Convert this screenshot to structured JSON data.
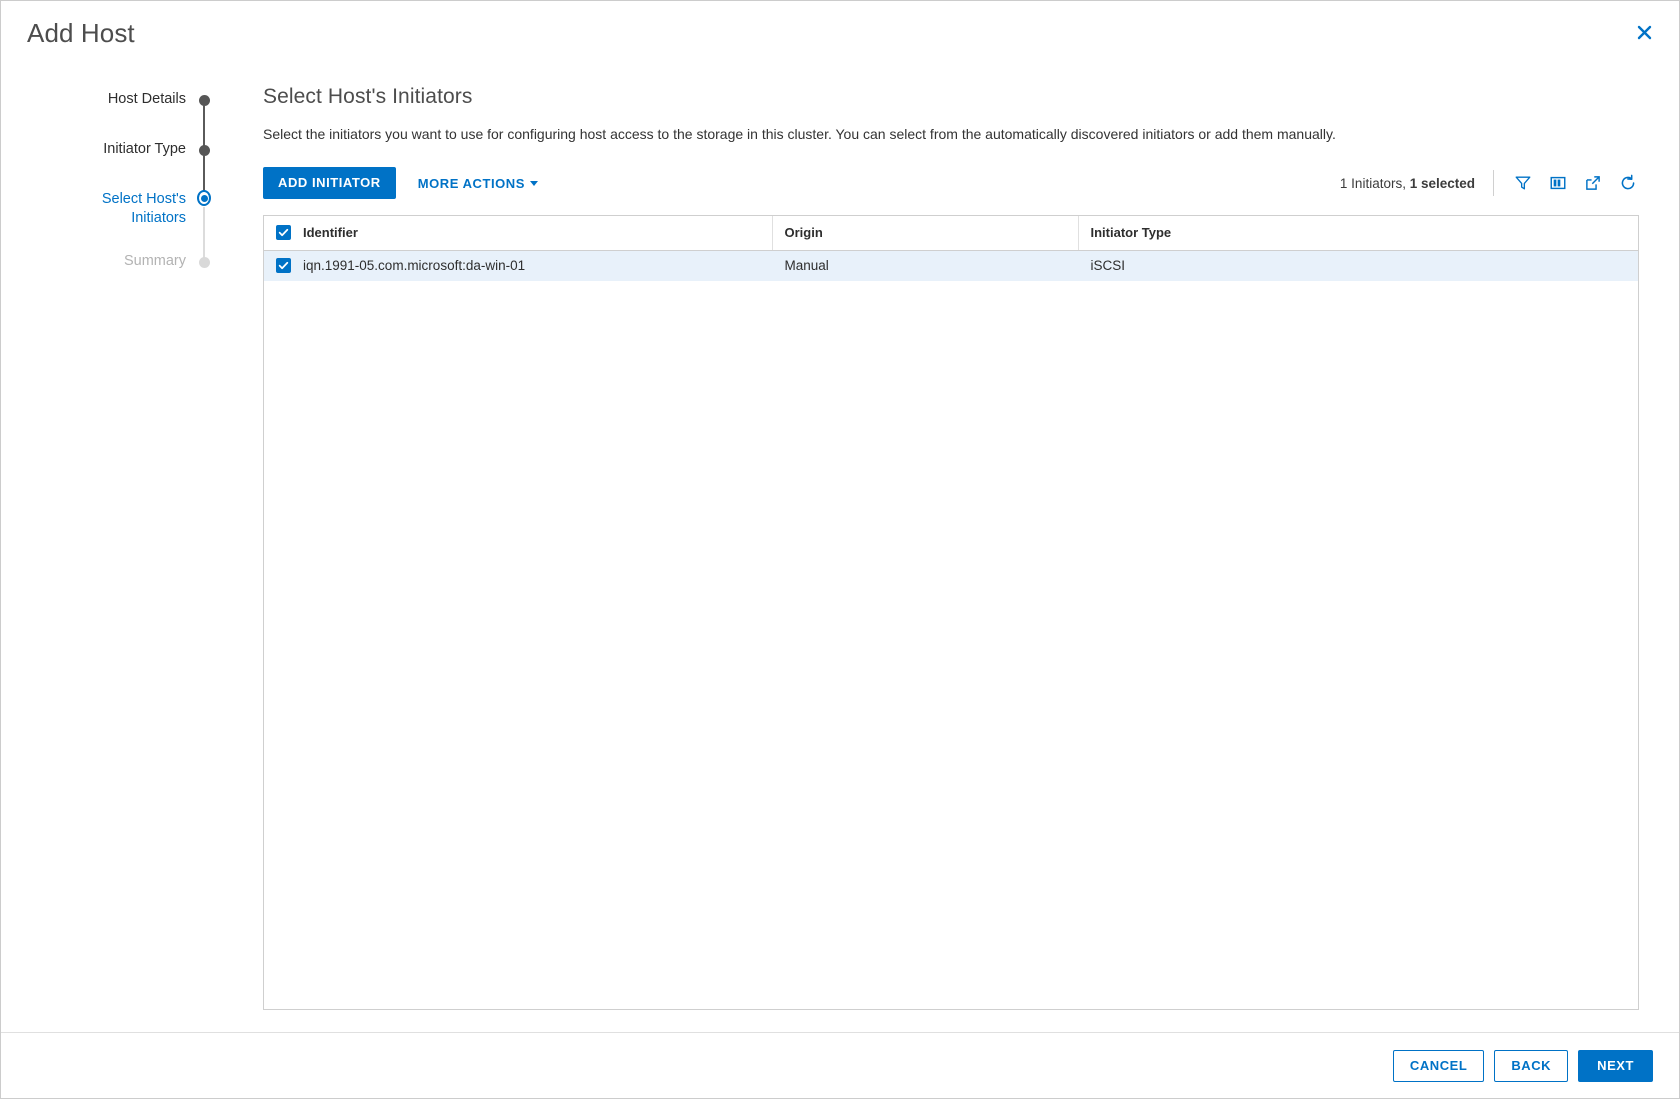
{
  "dialog": {
    "title": "Add Host",
    "close_icon": "close-icon",
    "accent_color": "#0072c6",
    "done_step_color": "#565656",
    "pending_step_color": "#d9d9d9",
    "row_selected_color": "#e8f1fa"
  },
  "stepper": {
    "steps": [
      {
        "label": "Host Details",
        "state": "done"
      },
      {
        "label": "Initiator Type",
        "state": "done"
      },
      {
        "label": "Select Host's Initiators",
        "state": "active"
      },
      {
        "label": "Summary",
        "state": "pending"
      }
    ]
  },
  "content": {
    "title": "Select Host's Initiators",
    "description": "Select the initiators you want to use for configuring host access to the storage in this cluster. You can select from the automatically discovered initiators or add them manually."
  },
  "toolbar": {
    "add_initiator_label": "ADD INITIATOR",
    "more_actions_label": "MORE ACTIONS",
    "count_prefix": "1 Initiators, ",
    "count_selected": "1 selected",
    "icons": [
      {
        "name": "filter-icon",
        "title": "Filter"
      },
      {
        "name": "columns-icon",
        "title": "Show/Hide Columns"
      },
      {
        "name": "export-icon",
        "title": "Export"
      },
      {
        "name": "refresh-icon",
        "title": "Refresh"
      }
    ]
  },
  "table": {
    "select_all_checked": true,
    "columns": [
      "Identifier",
      "Origin",
      "Initiator Type"
    ],
    "rows": [
      {
        "checked": true,
        "identifier": "iqn.1991-05.com.microsoft:da-win-01",
        "origin": "Manual",
        "initiator_type": "iSCSI"
      }
    ]
  },
  "footer": {
    "cancel_label": "CANCEL",
    "back_label": "BACK",
    "next_label": "NEXT"
  }
}
